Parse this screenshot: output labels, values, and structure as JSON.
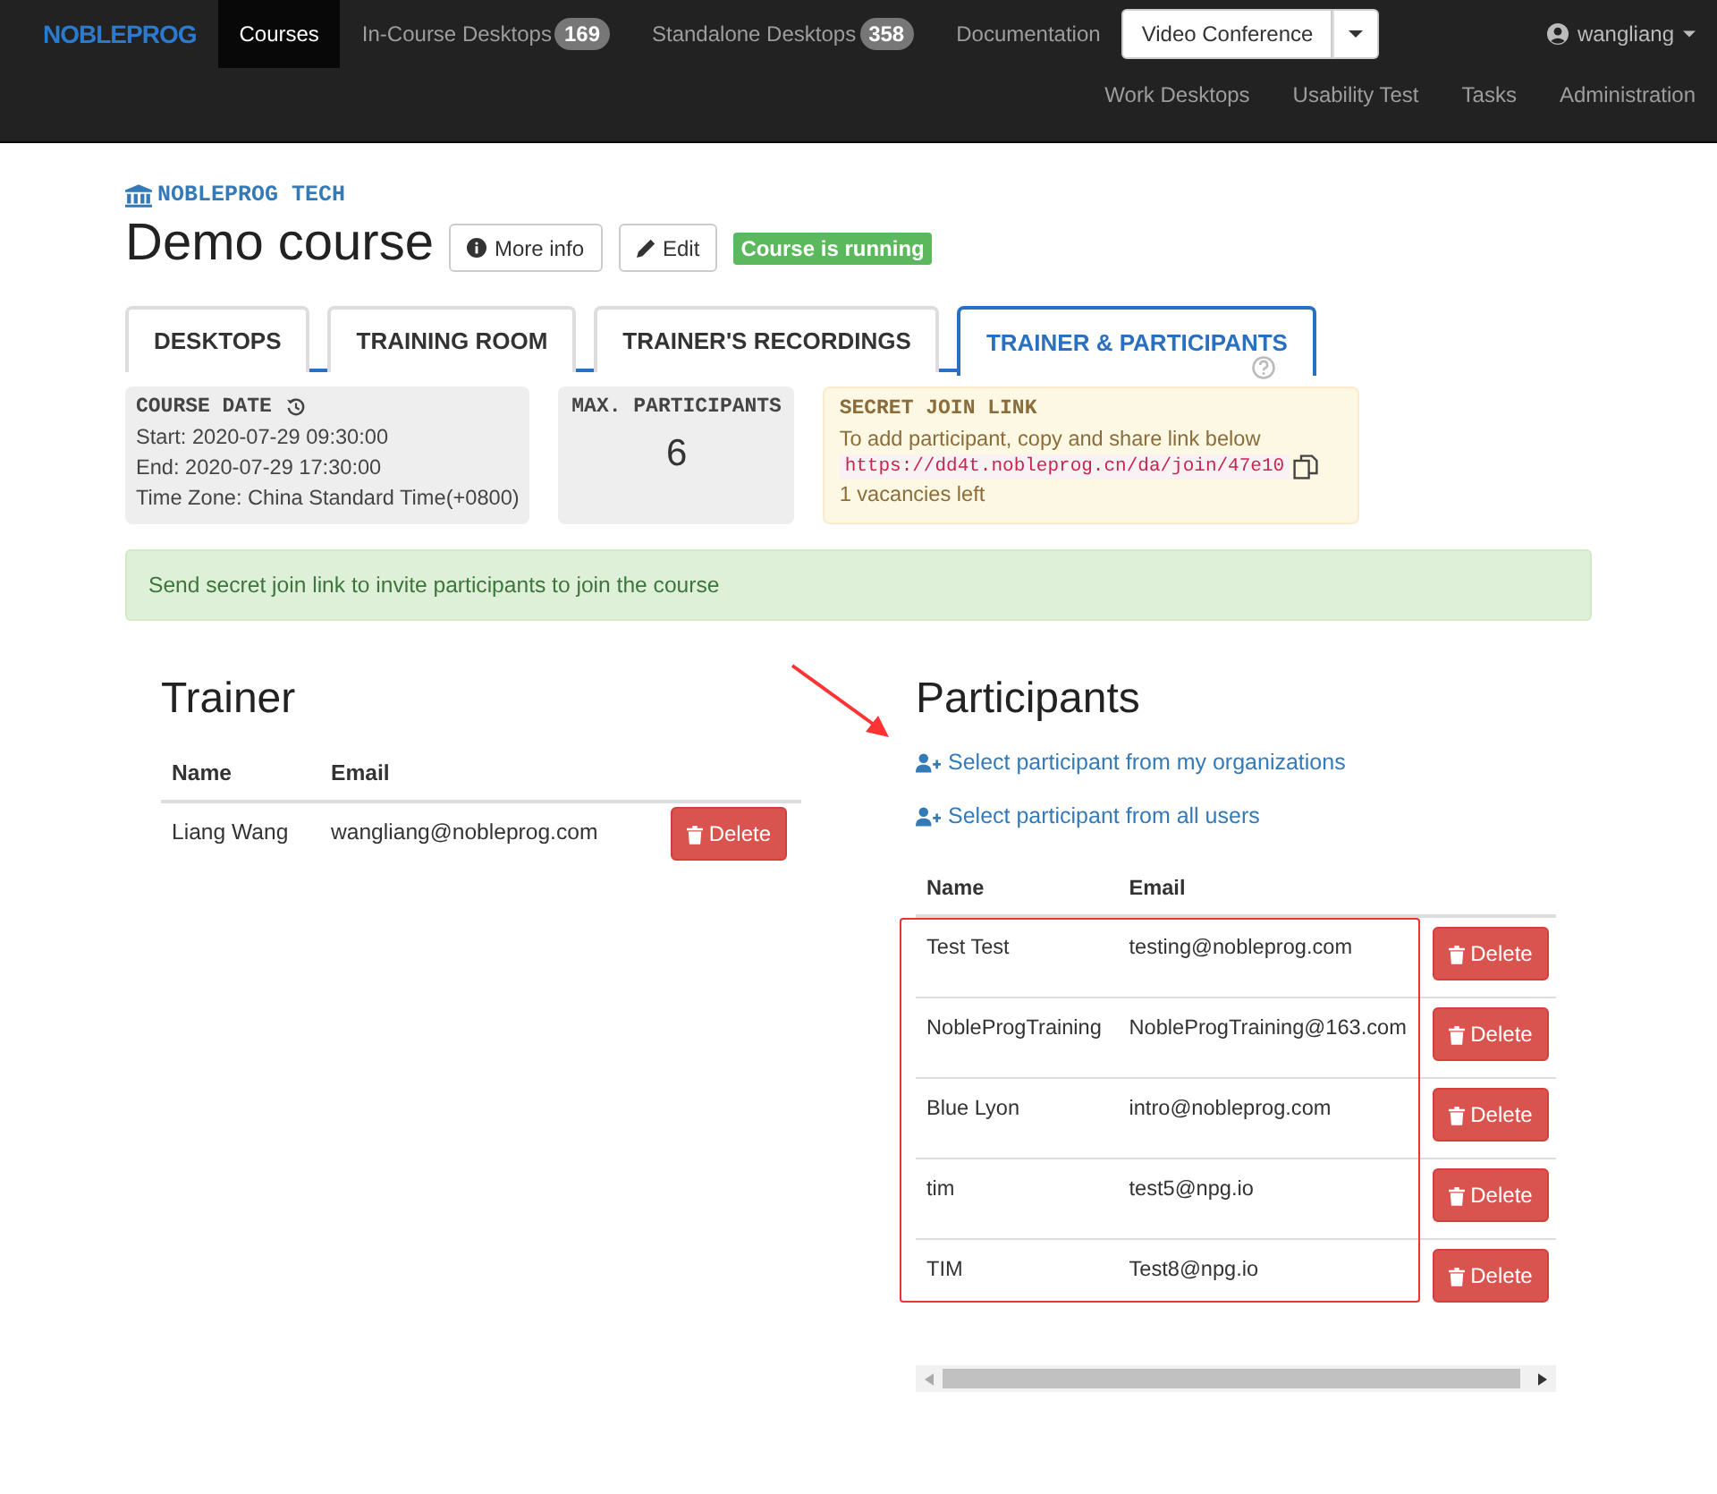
{
  "navbar": {
    "brand": "NOBLEPROG",
    "items": [
      {
        "label": "Courses",
        "selected": true
      },
      {
        "label": "In-Course Desktops",
        "badge": "169",
        "selected": false
      },
      {
        "label": "Standalone Desktops",
        "badge": "358",
        "selected": false
      },
      {
        "label": "Documentation",
        "selected": false
      }
    ],
    "video_button": "Video Conference",
    "user": "wangliang",
    "secondary": [
      "Work Desktops",
      "Usability Test",
      "Tasks",
      "Administration"
    ]
  },
  "course": {
    "organization": "NOBLEPROG TECH",
    "title": "Demo course",
    "buttons": [
      {
        "label": "More info",
        "kind": "info"
      },
      {
        "label": "Edit",
        "kind": "edit"
      }
    ],
    "status": "Course is running"
  },
  "tabs": [
    {
      "label": "DESKTOPS",
      "selected": false
    },
    {
      "label": "TRAINING ROOM",
      "selected": false
    },
    {
      "label": "TRAINER'S RECORDINGS",
      "selected": false
    },
    {
      "label": "TRAINER & PARTICIPANTS",
      "selected": true
    }
  ],
  "course_date": {
    "title": "COURSE DATE",
    "lines": [
      "Start: 2020-07-29 09:30:00",
      "End: 2020-07-29 17:30:00",
      "Time Zone: China Standard Time(+0800)"
    ]
  },
  "max_participants": {
    "title": "MAX. PARTICIPANTS",
    "value": "6"
  },
  "secret_link": {
    "title": "SECRET JOIN LINK",
    "hint": "To add participant, copy and share link below",
    "link": "https://dd4t.nobleprog.cn/da/join/47e10",
    "vacancies": "1 vacancies left"
  },
  "alert": "Send secret join link to invite participants to join the course",
  "trainer": {
    "heading": "Trainer",
    "columns": [
      "Name",
      "Email"
    ],
    "rows": [
      {
        "name": "Liang Wang",
        "email": "wangliang@nobleprog.com",
        "action": "Delete"
      }
    ]
  },
  "participants": {
    "heading": "Participants",
    "links": [
      "Select participant from my organizations",
      "Select participant from all users"
    ],
    "columns": [
      "Name",
      "Email"
    ],
    "rows": [
      {
        "name": "Test Test",
        "email": "testing@nobleprog.com",
        "action": "Delete"
      },
      {
        "name": "NobleProgTraining",
        "email": "NobleProgTraining@163.com",
        "action": "Delete"
      },
      {
        "name": "Blue Lyon",
        "email": "intro@nobleprog.com",
        "action": "Delete"
      },
      {
        "name": "tim",
        "email": "test5@npg.io",
        "action": "Delete"
      },
      {
        "name": "TIM",
        "email": "Test8@npg.io",
        "action": "Delete"
      }
    ]
  }
}
